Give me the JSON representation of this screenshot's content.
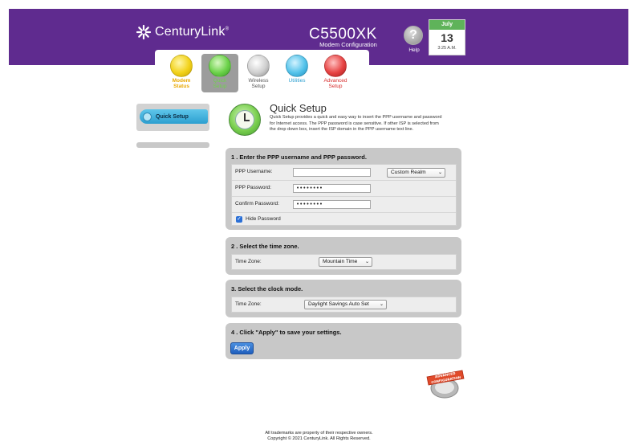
{
  "header": {
    "brand": "CenturyLink",
    "brand_mark": "®",
    "model": "C5500XK",
    "model_subtitle": "Modem Configuration",
    "help_label": "Help",
    "date": {
      "month": "July",
      "day": "13",
      "time": "3:25 A.M."
    }
  },
  "nav": {
    "items": [
      {
        "label1": "Modem",
        "label2": "Status",
        "color": "#e8a800"
      },
      {
        "label1": "Quick",
        "label2": "Setup",
        "color": "#3fae3a"
      },
      {
        "label1": "Wireless",
        "label2": "Setup",
        "color": "#555555"
      },
      {
        "label1": "Utilities",
        "label2": "",
        "color": "#2c9fd0"
      },
      {
        "label1": "Advanced",
        "label2": "Setup",
        "color": "#d62b2b"
      }
    ]
  },
  "sidebar": {
    "active_label": "Quick Setup"
  },
  "main": {
    "title": "Quick Setup",
    "description": "Quick Setup provides a quick and easy way to insert the PPP username and password for Internet access. The PPP password is case sensitive. If other ISP is selected from the drop down box, insert the ISP domain in the PPP username text line.",
    "step1": {
      "title": "1 . Enter the PPP username and PPP password.",
      "username_label": "PPP Username:",
      "username_value": "",
      "realm_select": "Custom Realm",
      "password_label": "PPP Password:",
      "password_value": "••••••••",
      "confirm_label": "Confirm Password:",
      "confirm_value": "••••••••",
      "hide_password_label": "Hide Password",
      "hide_password_checked": true
    },
    "step2": {
      "title": "2 . Select the time zone.",
      "label": "Time Zone:",
      "select": "Mountain Time"
    },
    "step3": {
      "title": "3. Select the clock mode.",
      "label": "Time Zone:",
      "select": "Daylight Savings Auto Set"
    },
    "step4": {
      "title": "4 . Click \"Apply\" to save your settings.",
      "apply_label": "Apply"
    }
  },
  "badge": {
    "line1": "ADVANCED",
    "line2": "CONFIGURATION"
  },
  "footer": {
    "line1": "All trademarks are property of their respective owners.",
    "line2": "Copyright © 2021 CenturyLink. All Rights Reserved."
  }
}
